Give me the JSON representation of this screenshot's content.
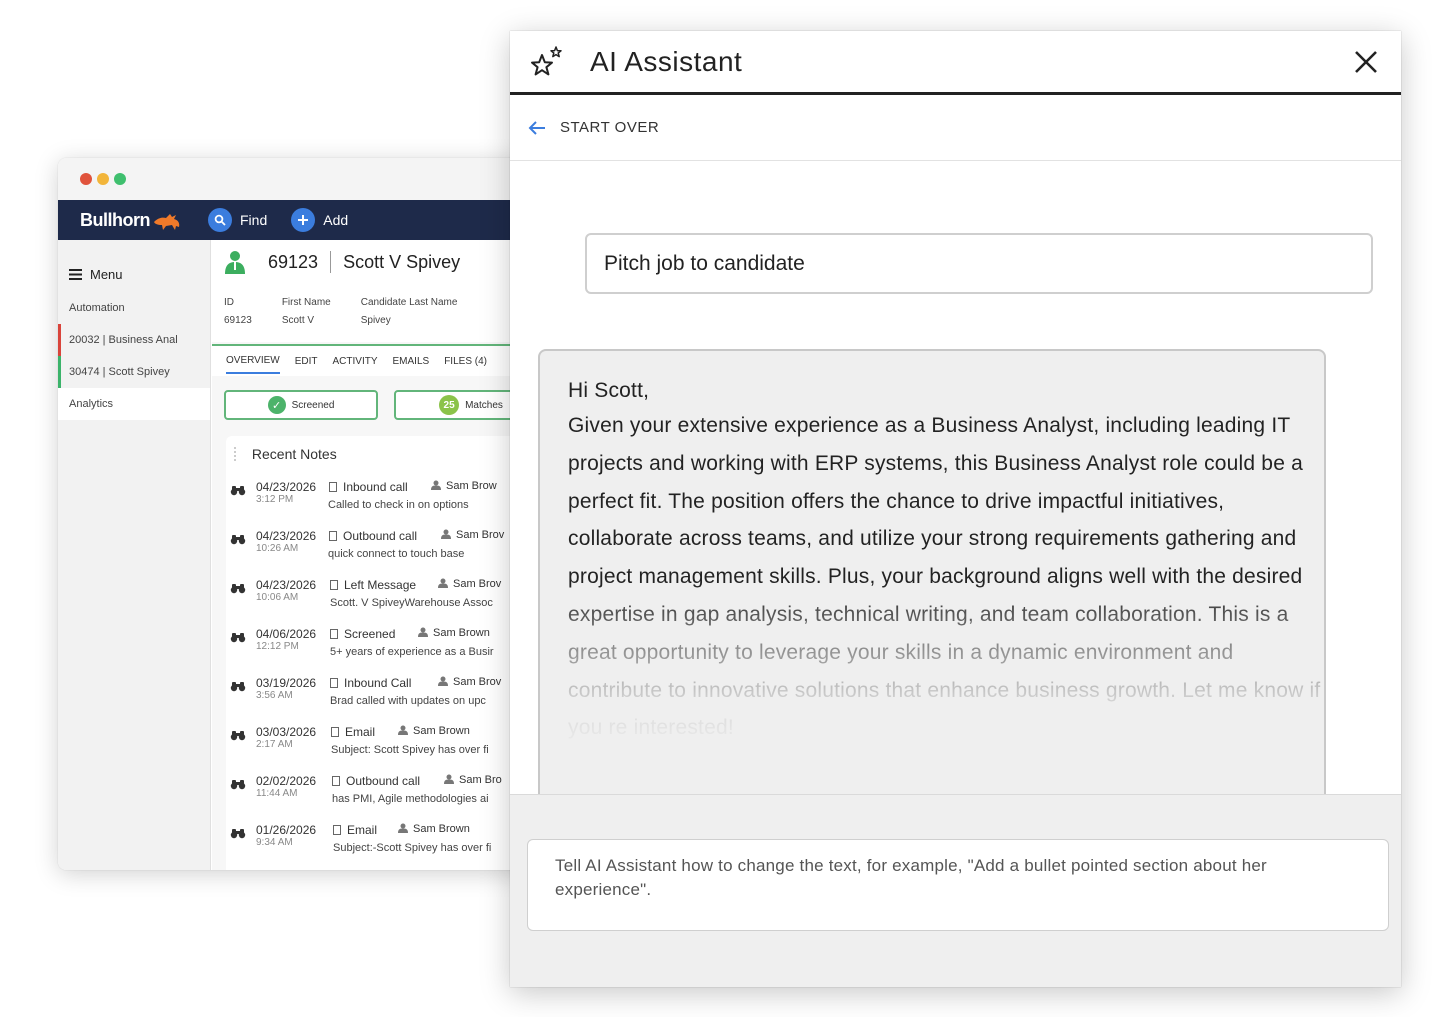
{
  "bullhorn": {
    "window_dots": [
      "#e0533c",
      "#f2b53a",
      "#3fbf6e"
    ],
    "brand": "Bullhorn",
    "nav": {
      "find_label": "Find",
      "add_label": "Add"
    },
    "sidebar": {
      "menu_label": "Menu",
      "items": [
        {
          "label": "Automation"
        },
        {
          "label": "20032 | Business Anal"
        },
        {
          "label": "30474 | Scott Spivey"
        },
        {
          "label": "Analytics"
        }
      ]
    },
    "record": {
      "id": "69123",
      "name": "Scott V Spivey",
      "fields": [
        {
          "label": "ID",
          "value": "69123"
        },
        {
          "label": "First Name",
          "value": "Scott V"
        },
        {
          "label": "Candidate Last Name",
          "value": "Spivey"
        }
      ],
      "tabs": [
        "OVERVIEW",
        "EDIT",
        "ACTIVITY",
        "EMAILS",
        "FILES (4)"
      ],
      "status_chip": "Screened",
      "matches_count": "25",
      "matches_label": "Matches"
    },
    "notes": {
      "title": "Recent Notes",
      "items": [
        {
          "date": "04/23/2026",
          "time": "3:12 PM",
          "type": "Inbound call",
          "user": "Sam Brow",
          "text": "Called to check in on options"
        },
        {
          "date": "04/23/2026",
          "time": "10:26 AM",
          "type": "Outbound call",
          "user": "Sam Brov",
          "text": "quick connect to touch base"
        },
        {
          "date": "04/23/2026",
          "time": "10:06 AM",
          "type": "Left Message",
          "user": "Sam Brov",
          "text": "Scott. V SpiveyWarehouse Assoc"
        },
        {
          "date": "04/06/2026",
          "time": "12:12 PM",
          "type": "Screened",
          "user": "Sam Brown",
          "text": "5+ years of experience as a Busir"
        },
        {
          "date": "03/19/2026",
          "time": "3:56 AM",
          "type": "Inbound Call",
          "user": "Sam Brov",
          "text": "Brad called with updates on upc"
        },
        {
          "date": "03/03/2026",
          "time": "2:17 AM",
          "type": "Email",
          "user": "Sam Brown",
          "text": "Subject: Scott Spivey has over fi"
        },
        {
          "date": "02/02/2026",
          "time": "11:44 AM",
          "type": "Outbound call",
          "user": "Sam Bro",
          "text": "has PMI, Agile methodologies ai"
        },
        {
          "date": "01/26/2026",
          "time": "9:34 AM",
          "type": "Email",
          "user": "Sam Brown",
          "text": "Subject:-Scott Spivey has over fi"
        }
      ]
    }
  },
  "ai": {
    "title": "AI Assistant",
    "start_over": "START OVER",
    "prompt": "Pitch job to candidate",
    "greeting": "Hi Scott,",
    "body": "Given your extensive experience as a Business Analyst, including leading IT projects and working with ERP systems, this Business Analyst role could be a perfect fit. The position offers the chance to drive impactful initiatives, collaborate across teams, and utilize your strong requirements gathering and project management skills. Plus, your background aligns well with the desired expertise in gap analysis, technical writing, and team collaboration. This is a great opportunity to leverage your skills in a dynamic environment and contribute to innovative solutions that enhance business growth. Let me know if you re interested!",
    "instruction_placeholder": "Tell AI Assistant how to change the text, for example, \"Add a bullet pointed section about her experience\"."
  }
}
